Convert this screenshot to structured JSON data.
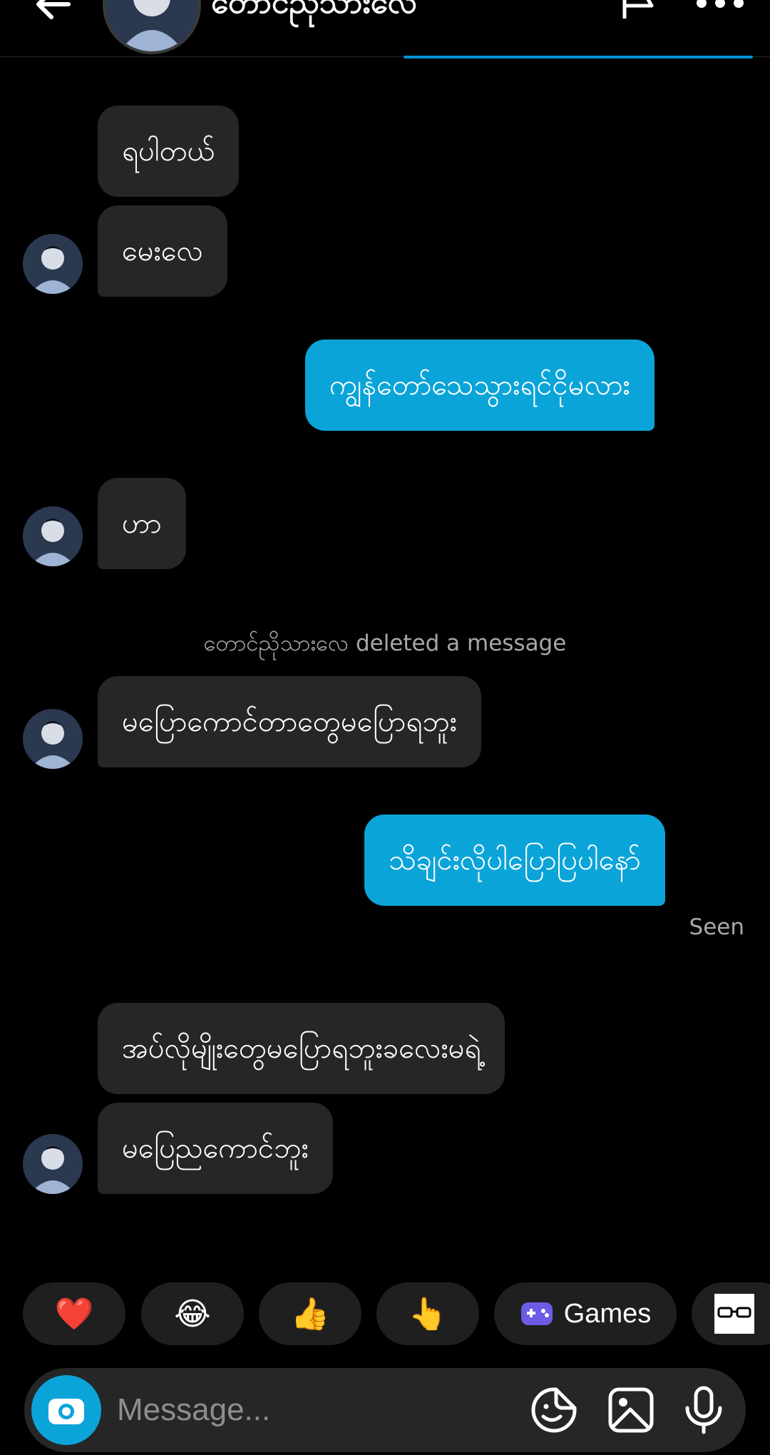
{
  "header": {
    "contact_name": "တောင်ညိုသားလေ"
  },
  "messages": [
    {
      "text": "ရပါတယ်",
      "direction": "incoming"
    },
    {
      "text": "မေးလေ",
      "direction": "incoming"
    },
    {
      "text": "ကျွန်တော်သေသွားရင်ငိုမလား",
      "direction": "outgoing"
    },
    {
      "text": "ဟာ",
      "direction": "incoming"
    },
    {
      "text": "မပြောကောင်တာတွေမပြောရဘူး",
      "direction": "incoming"
    },
    {
      "text": "သိချင်းလိုပါပြောပြပါနော်",
      "direction": "outgoing"
    },
    {
      "text": "အပ်လိုမျိုးတွေမပြောရဘူးခလေးမရဲ့",
      "direction": "incoming"
    },
    {
      "text": "မပြေညကောင်ဘူး",
      "direction": "incoming"
    }
  ],
  "system_note": {
    "name": "တောင်ညိုသားလေ",
    "action": " deleted a message"
  },
  "seen_label": "Seen",
  "quick_reactions": {
    "heart": "❤️",
    "laugh": "😂",
    "thumbs_up": "👍",
    "pointing": "👆",
    "games_label": "Games"
  },
  "composer": {
    "placeholder": "Message..."
  },
  "colors": {
    "outgoing_bubble": "#0ba4d9",
    "incoming_bubble": "#262626",
    "background": "#000000",
    "accent": "#0095d8"
  },
  "icons": [
    "back-arrow-icon",
    "flag-icon",
    "more-icon",
    "camera-icon",
    "sticker-icon",
    "gallery-icon",
    "microphone-icon",
    "gamepad-icon",
    "glasses-icon"
  ]
}
